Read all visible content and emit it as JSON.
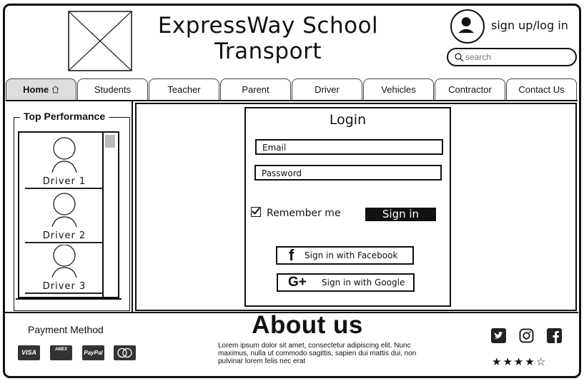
{
  "header": {
    "title_line1": "ExpressWay School",
    "title_line2": "Transport",
    "signup_label": "sign up/log in",
    "search_placeholder": "search"
  },
  "nav": {
    "tabs": [
      {
        "label": "Home"
      },
      {
        "label": "Students"
      },
      {
        "label": "Teacher"
      },
      {
        "label": "Parent"
      },
      {
        "label": "Driver"
      },
      {
        "label": "Vehicles"
      },
      {
        "label": "Contractor"
      },
      {
        "label": "Contact Us"
      }
    ]
  },
  "top_performance": {
    "title": "Top Performance",
    "drivers": [
      "Driver 1",
      "Driver 2",
      "Driver 3"
    ]
  },
  "login": {
    "title": "Login",
    "email_placeholder": "Email",
    "password_placeholder": "Password",
    "remember_label": "Remember me",
    "signin_label": "Sign in",
    "facebook_label": "Sign in with Facebook",
    "google_label": "Sign in with Google"
  },
  "footer": {
    "payment_title": "Payment Method",
    "cards": [
      "VISA",
      "AMEX",
      "PayPal",
      "MC"
    ],
    "about_title": "About us",
    "about_text": "Lorem ipsum dolor sit amet, consectetur adipiscing elit. Nunc maximus, nulla ut commodo sagittis, sapien dui mattis dui, non pulvinar lorem felis nec erat",
    "rating": 4
  },
  "colors": {
    "active_tab": "#dddddd",
    "ink": "#111111"
  },
  "icons": [
    "image-placeholder-icon",
    "user-avatar-icon",
    "search-icon",
    "home-icon",
    "facebook-icon",
    "google-plus-icon",
    "twitter-icon",
    "instagram-icon",
    "star-icon"
  ]
}
